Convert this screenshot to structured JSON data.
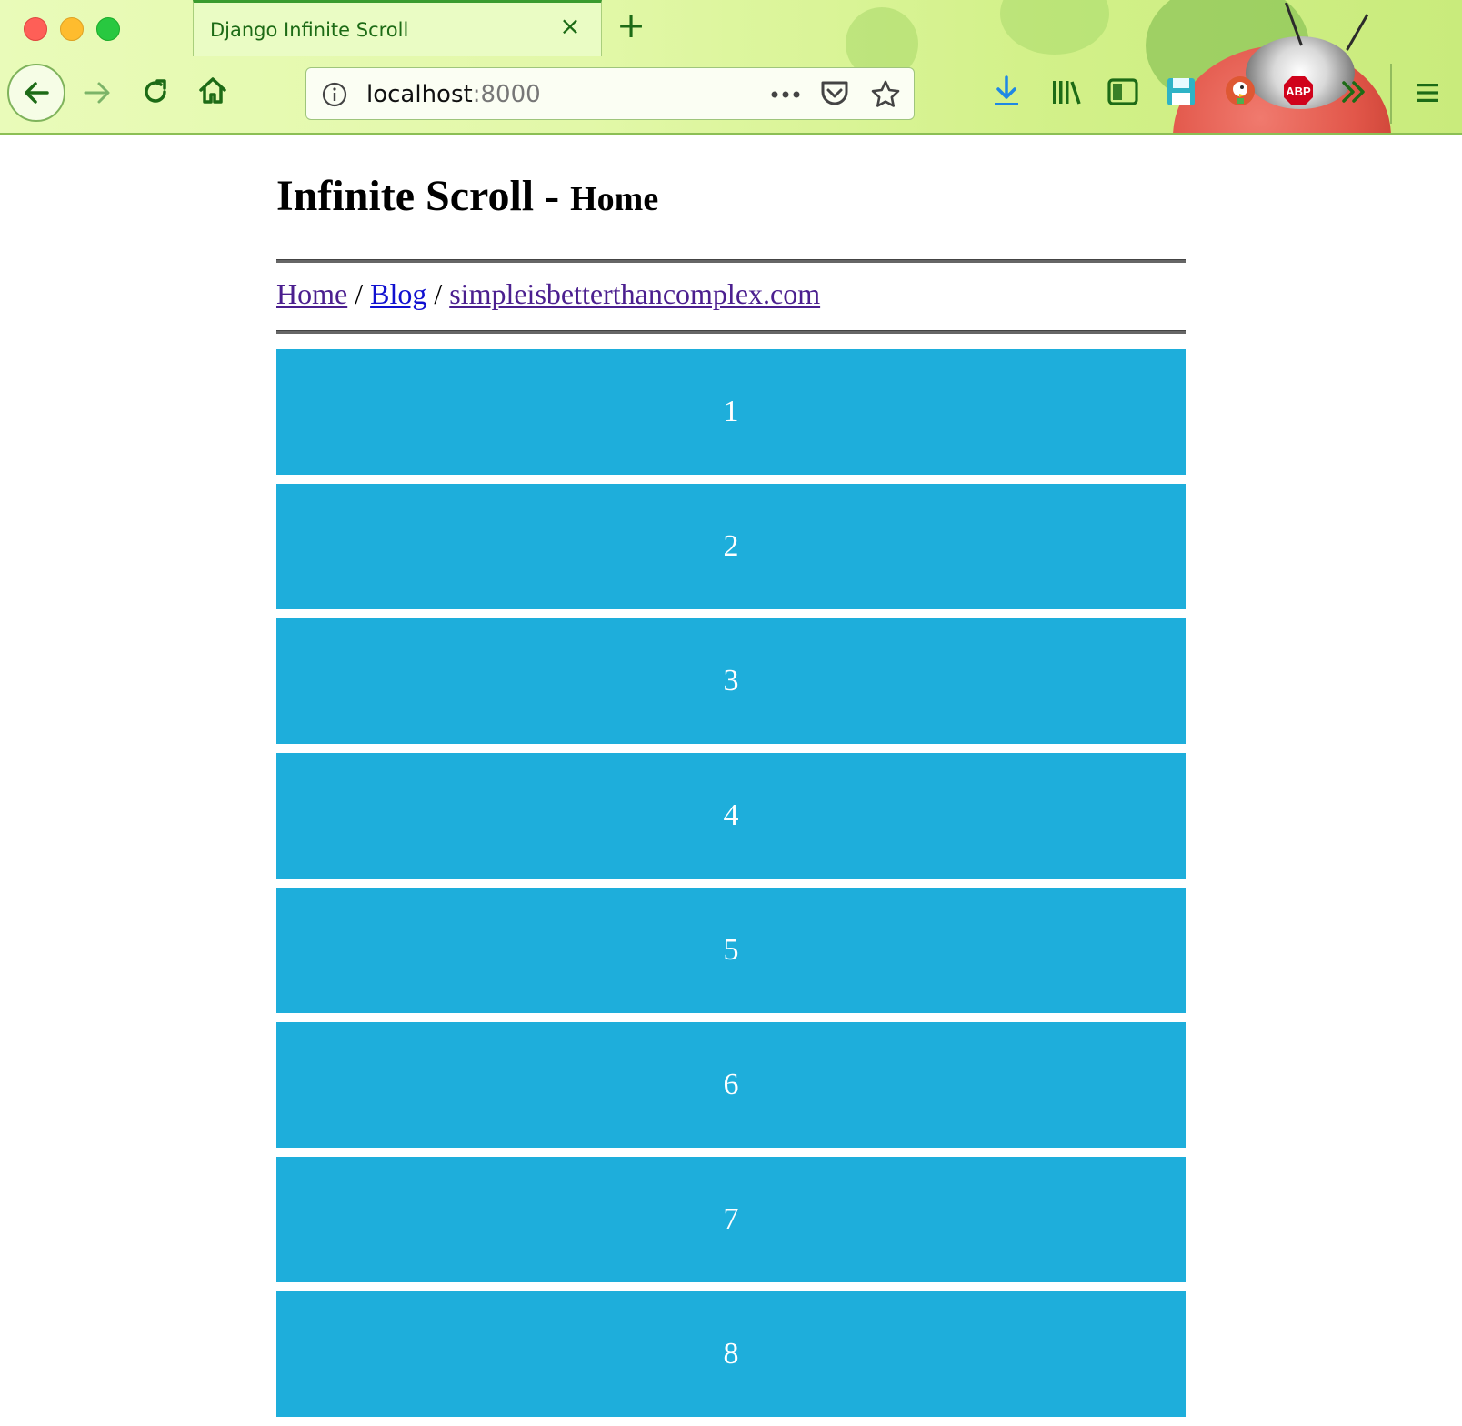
{
  "browser": {
    "tab_title": "Django Infinite Scroll",
    "url_host": "localhost",
    "url_port": ":8000",
    "icons": [
      "back-icon",
      "forward-icon",
      "reload-icon",
      "home-icon",
      "info-icon",
      "page-actions-icon",
      "pocket-icon",
      "bookmark-star-icon",
      "download-icon",
      "library-icon",
      "sidebar-icon",
      "save-icon",
      "duckduckgo-icon",
      "adblock-icon",
      "overflow-icon",
      "menu-icon"
    ],
    "adblock_label": "ABP"
  },
  "page": {
    "title": "Infinite Scroll -",
    "subtitle": "Home",
    "breadcrumb": {
      "home": "Home",
      "sep1": " / ",
      "blog": "Blog",
      "sep2": " / ",
      "site": "simpleisbetterthancomplex.com"
    },
    "items": [
      "1",
      "2",
      "3",
      "4",
      "5",
      "6",
      "7",
      "8"
    ]
  },
  "colors": {
    "item_bg": "#1eaedb",
    "chrome_green": "#1d6b16"
  }
}
